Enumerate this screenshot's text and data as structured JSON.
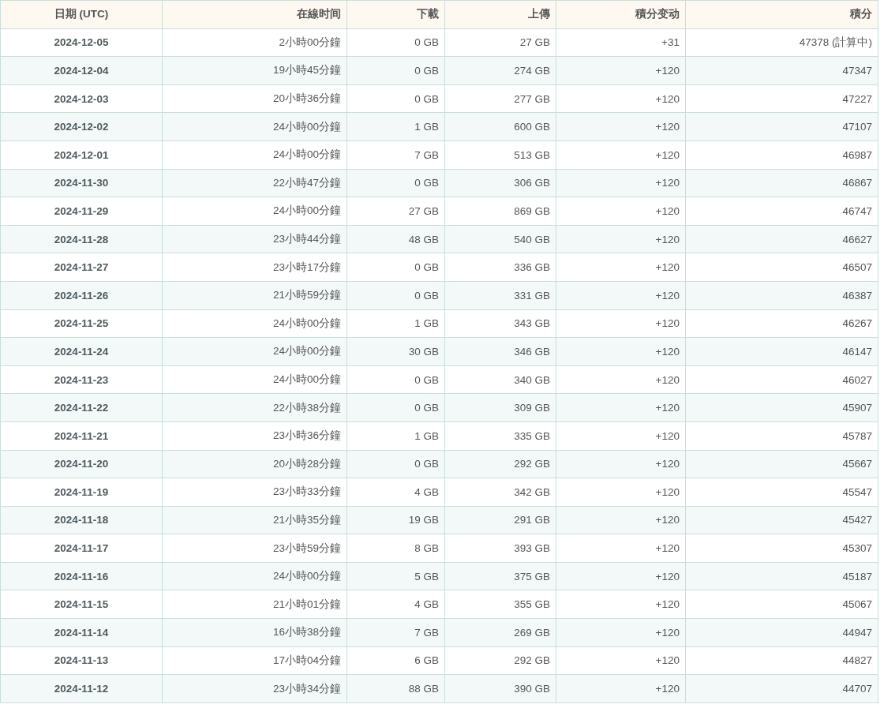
{
  "table": {
    "columns": [
      "日期 (UTC)",
      "在線时间",
      "下載",
      "上傳",
      "積分变动",
      "積分"
    ],
    "rows": [
      [
        "2024-12-05",
        "2小時00分鐘",
        "0 GB",
        "27 GB",
        "+31",
        "47378 (計算中)"
      ],
      [
        "2024-12-04",
        "19小時45分鐘",
        "0 GB",
        "274 GB",
        "+120",
        "47347"
      ],
      [
        "2024-12-03",
        "20小時36分鐘",
        "0 GB",
        "277 GB",
        "+120",
        "47227"
      ],
      [
        "2024-12-02",
        "24小時00分鐘",
        "1 GB",
        "600 GB",
        "+120",
        "47107"
      ],
      [
        "2024-12-01",
        "24小時00分鐘",
        "7 GB",
        "513 GB",
        "+120",
        "46987"
      ],
      [
        "2024-11-30",
        "22小時47分鐘",
        "0 GB",
        "306 GB",
        "+120",
        "46867"
      ],
      [
        "2024-11-29",
        "24小時00分鐘",
        "27 GB",
        "869 GB",
        "+120",
        "46747"
      ],
      [
        "2024-11-28",
        "23小時44分鐘",
        "48 GB",
        "540 GB",
        "+120",
        "46627"
      ],
      [
        "2024-11-27",
        "23小時17分鐘",
        "0 GB",
        "336 GB",
        "+120",
        "46507"
      ],
      [
        "2024-11-26",
        "21小時59分鐘",
        "0 GB",
        "331 GB",
        "+120",
        "46387"
      ],
      [
        "2024-11-25",
        "24小時00分鐘",
        "1 GB",
        "343 GB",
        "+120",
        "46267"
      ],
      [
        "2024-11-24",
        "24小時00分鐘",
        "30 GB",
        "346 GB",
        "+120",
        "46147"
      ],
      [
        "2024-11-23",
        "24小時00分鐘",
        "0 GB",
        "340 GB",
        "+120",
        "46027"
      ],
      [
        "2024-11-22",
        "22小時38分鐘",
        "0 GB",
        "309 GB",
        "+120",
        "45907"
      ],
      [
        "2024-11-21",
        "23小時36分鐘",
        "1 GB",
        "335 GB",
        "+120",
        "45787"
      ],
      [
        "2024-11-20",
        "20小時28分鐘",
        "0 GB",
        "292 GB",
        "+120",
        "45667"
      ],
      [
        "2024-11-19",
        "23小時33分鐘",
        "4 GB",
        "342 GB",
        "+120",
        "45547"
      ],
      [
        "2024-11-18",
        "21小時35分鐘",
        "19 GB",
        "291 GB",
        "+120",
        "45427"
      ],
      [
        "2024-11-17",
        "23小時59分鐘",
        "8 GB",
        "393 GB",
        "+120",
        "45307"
      ],
      [
        "2024-11-16",
        "24小時00分鐘",
        "5 GB",
        "375 GB",
        "+120",
        "45187"
      ],
      [
        "2024-11-15",
        "21小時01分鐘",
        "4 GB",
        "355 GB",
        "+120",
        "45067"
      ],
      [
        "2024-11-14",
        "16小時38分鐘",
        "7 GB",
        "269 GB",
        "+120",
        "44947"
      ],
      [
        "2024-11-13",
        "17小時04分鐘",
        "6 GB",
        "292 GB",
        "+120",
        "44827"
      ],
      [
        "2024-11-12",
        "23小時34分鐘",
        "88 GB",
        "390 GB",
        "+120",
        "44707"
      ]
    ]
  }
}
